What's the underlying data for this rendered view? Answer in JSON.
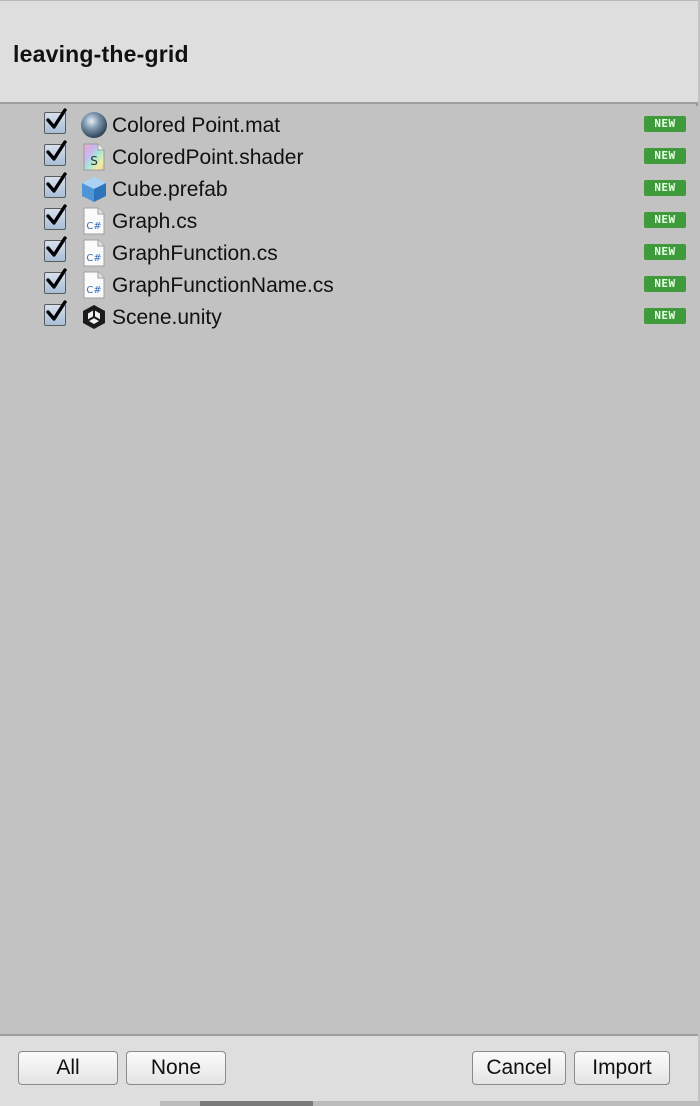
{
  "window": {
    "title": "leaving-the-grid"
  },
  "items": [
    {
      "label": "Colored Point.mat",
      "icon": "material-sphere-icon",
      "checked": true,
      "badge": "NEW"
    },
    {
      "label": "ColoredPoint.shader",
      "icon": "shader-icon",
      "checked": true,
      "badge": "NEW"
    },
    {
      "label": "Cube.prefab",
      "icon": "prefab-cube-icon",
      "checked": true,
      "badge": "NEW"
    },
    {
      "label": "Graph.cs",
      "icon": "csharp-script-icon",
      "checked": true,
      "badge": "NEW"
    },
    {
      "label": "GraphFunction.cs",
      "icon": "csharp-script-icon",
      "checked": true,
      "badge": "NEW"
    },
    {
      "label": "GraphFunctionName.cs",
      "icon": "csharp-script-icon",
      "checked": true,
      "badge": "NEW"
    },
    {
      "label": "Scene.unity",
      "icon": "unity-scene-icon",
      "checked": true,
      "badge": "NEW"
    }
  ],
  "icon_text": {
    "shader": "S",
    "csharp": "C#"
  },
  "buttons": {
    "all": "All",
    "none": "None",
    "cancel": "Cancel",
    "import": "Import"
  },
  "colors": {
    "badge": "#3e9a3a",
    "list_bg": "#c2c2c2",
    "header_bg": "#dedede"
  }
}
